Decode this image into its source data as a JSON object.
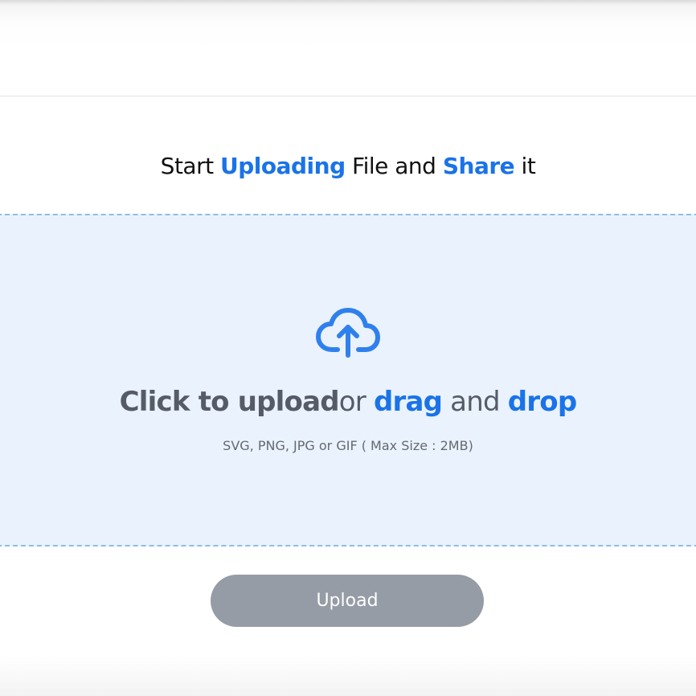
{
  "heading": {
    "part1": "Start ",
    "accent1": "Uploading",
    "part2": " File and ",
    "accent2": "Share",
    "part3": " it"
  },
  "dropzone": {
    "icon": "cloud-upload-icon",
    "cta": {
      "bold": "Click to upload",
      "or": "or ",
      "drag": "drag",
      "and": " and ",
      "drop": "drop"
    },
    "hint": "SVG, PNG, JPG or GIF ( Max Size : 2MB)"
  },
  "upload_button": {
    "label": "Upload"
  },
  "colors": {
    "accent": "#1a73e8",
    "dropzone_bg": "#eaf2fd",
    "dropzone_border": "#8fbde8",
    "button_bg": "#969ca6"
  }
}
